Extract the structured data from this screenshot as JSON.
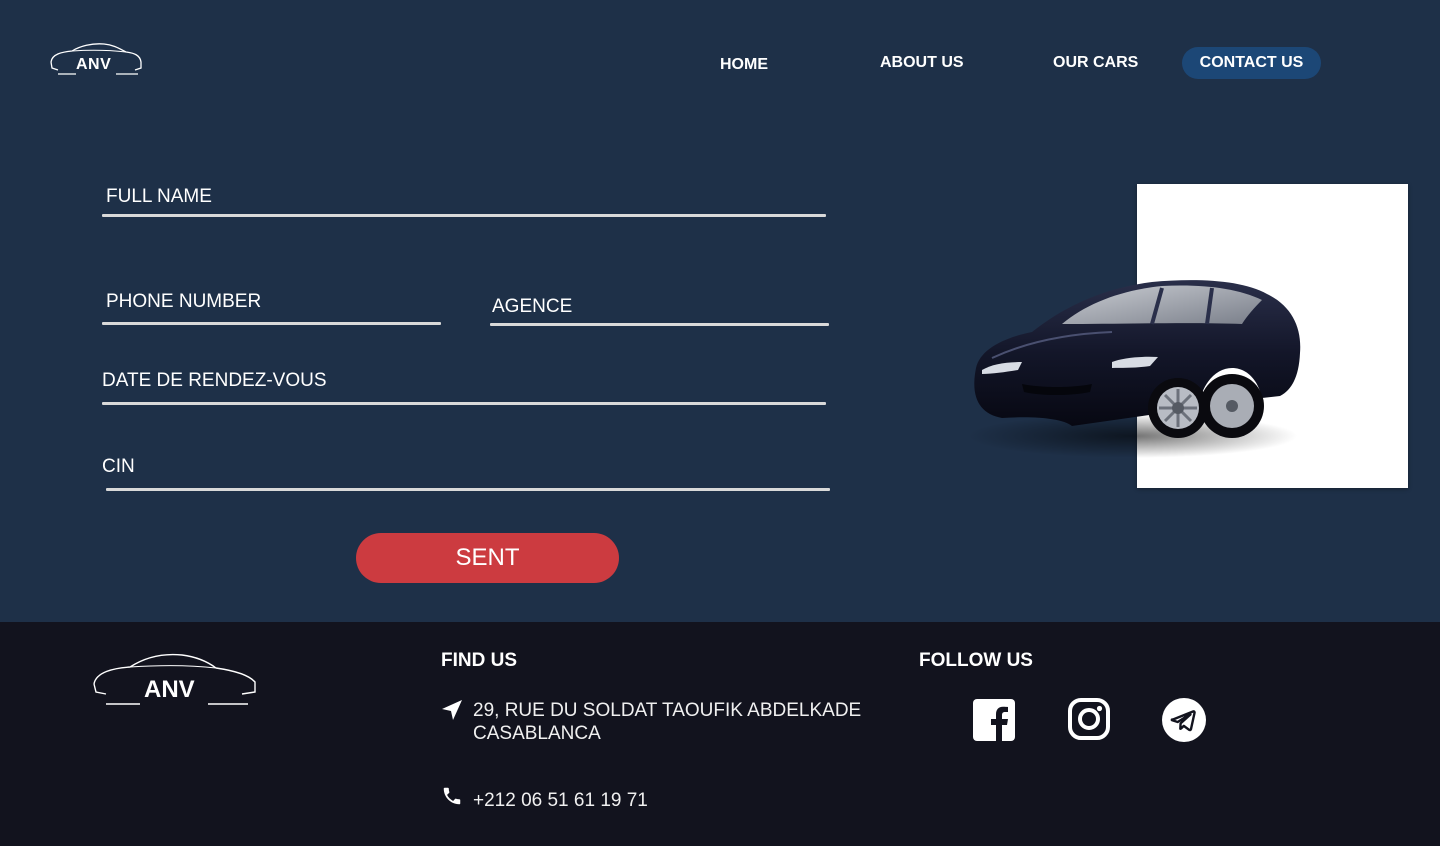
{
  "brand": {
    "name": "ANV"
  },
  "nav": {
    "home": "HOME",
    "about": "ABOUT US",
    "cars": "OUR CARS",
    "contact": "CONTACT US"
  },
  "form": {
    "full_name": "FULL NAME",
    "phone": "PHONE NUMBER",
    "agence": "AGENCE",
    "date": "DATE DE RENDEZ-VOUS",
    "cin": "CIN",
    "submit": "SENT"
  },
  "footer": {
    "find_title": "FIND US",
    "address_line1": "29, RUE DU SOLDAT TAOUFIK ABDELKADE",
    "address_line2": "CASABLANCA",
    "phone": "+212 06 51 61 19 71",
    "follow_title": "FOLLOW US",
    "social": [
      "facebook-icon",
      "instagram-icon",
      "telegram-icon"
    ]
  },
  "colors": {
    "background": "#1e3048",
    "footer": "#12131e",
    "accent_button": "#cc3b40",
    "nav_pill": "#1c4776"
  }
}
